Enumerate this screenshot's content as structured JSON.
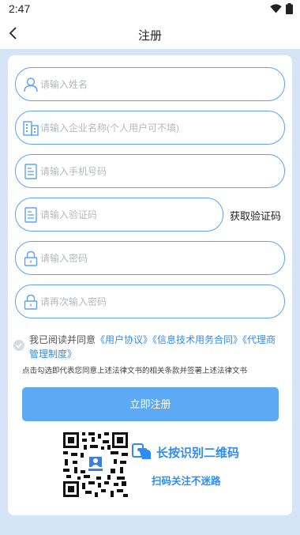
{
  "status_bar": {
    "time": "2:47"
  },
  "app_bar": {
    "title": "注册"
  },
  "form": {
    "name_placeholder": "请输入姓名",
    "company_placeholder": "请输入企业名称(个人用户可不填)",
    "phone_placeholder": "请输入手机号码",
    "code_placeholder": "请输入验证码",
    "get_code_label": "获取验证码",
    "password_placeholder": "请输入密码",
    "password_confirm_placeholder": "请再次输入密码"
  },
  "agreement": {
    "prefix": "我已阅读并同意",
    "links": [
      "《用户协议》",
      "《信息技术用务合同》",
      "《代理商管理制度》"
    ],
    "notice": "点击勾选即代表您同意上述法律文书的相关条款并签署上述法律文书"
  },
  "submit_label": "立即注册",
  "qr": {
    "hint": "长按识别二维码",
    "sub": "扫码关注不迷路"
  },
  "colors": {
    "accent": "#2f8cf0",
    "border": "#5ba3f2",
    "button": "#5ea9f3",
    "background": "#d6e4f8"
  },
  "icons": {
    "name": "user-icon",
    "company": "building-icon",
    "phone": "document-icon",
    "code": "document-icon",
    "password": "lock-icon",
    "password_confirm": "lock-icon"
  }
}
